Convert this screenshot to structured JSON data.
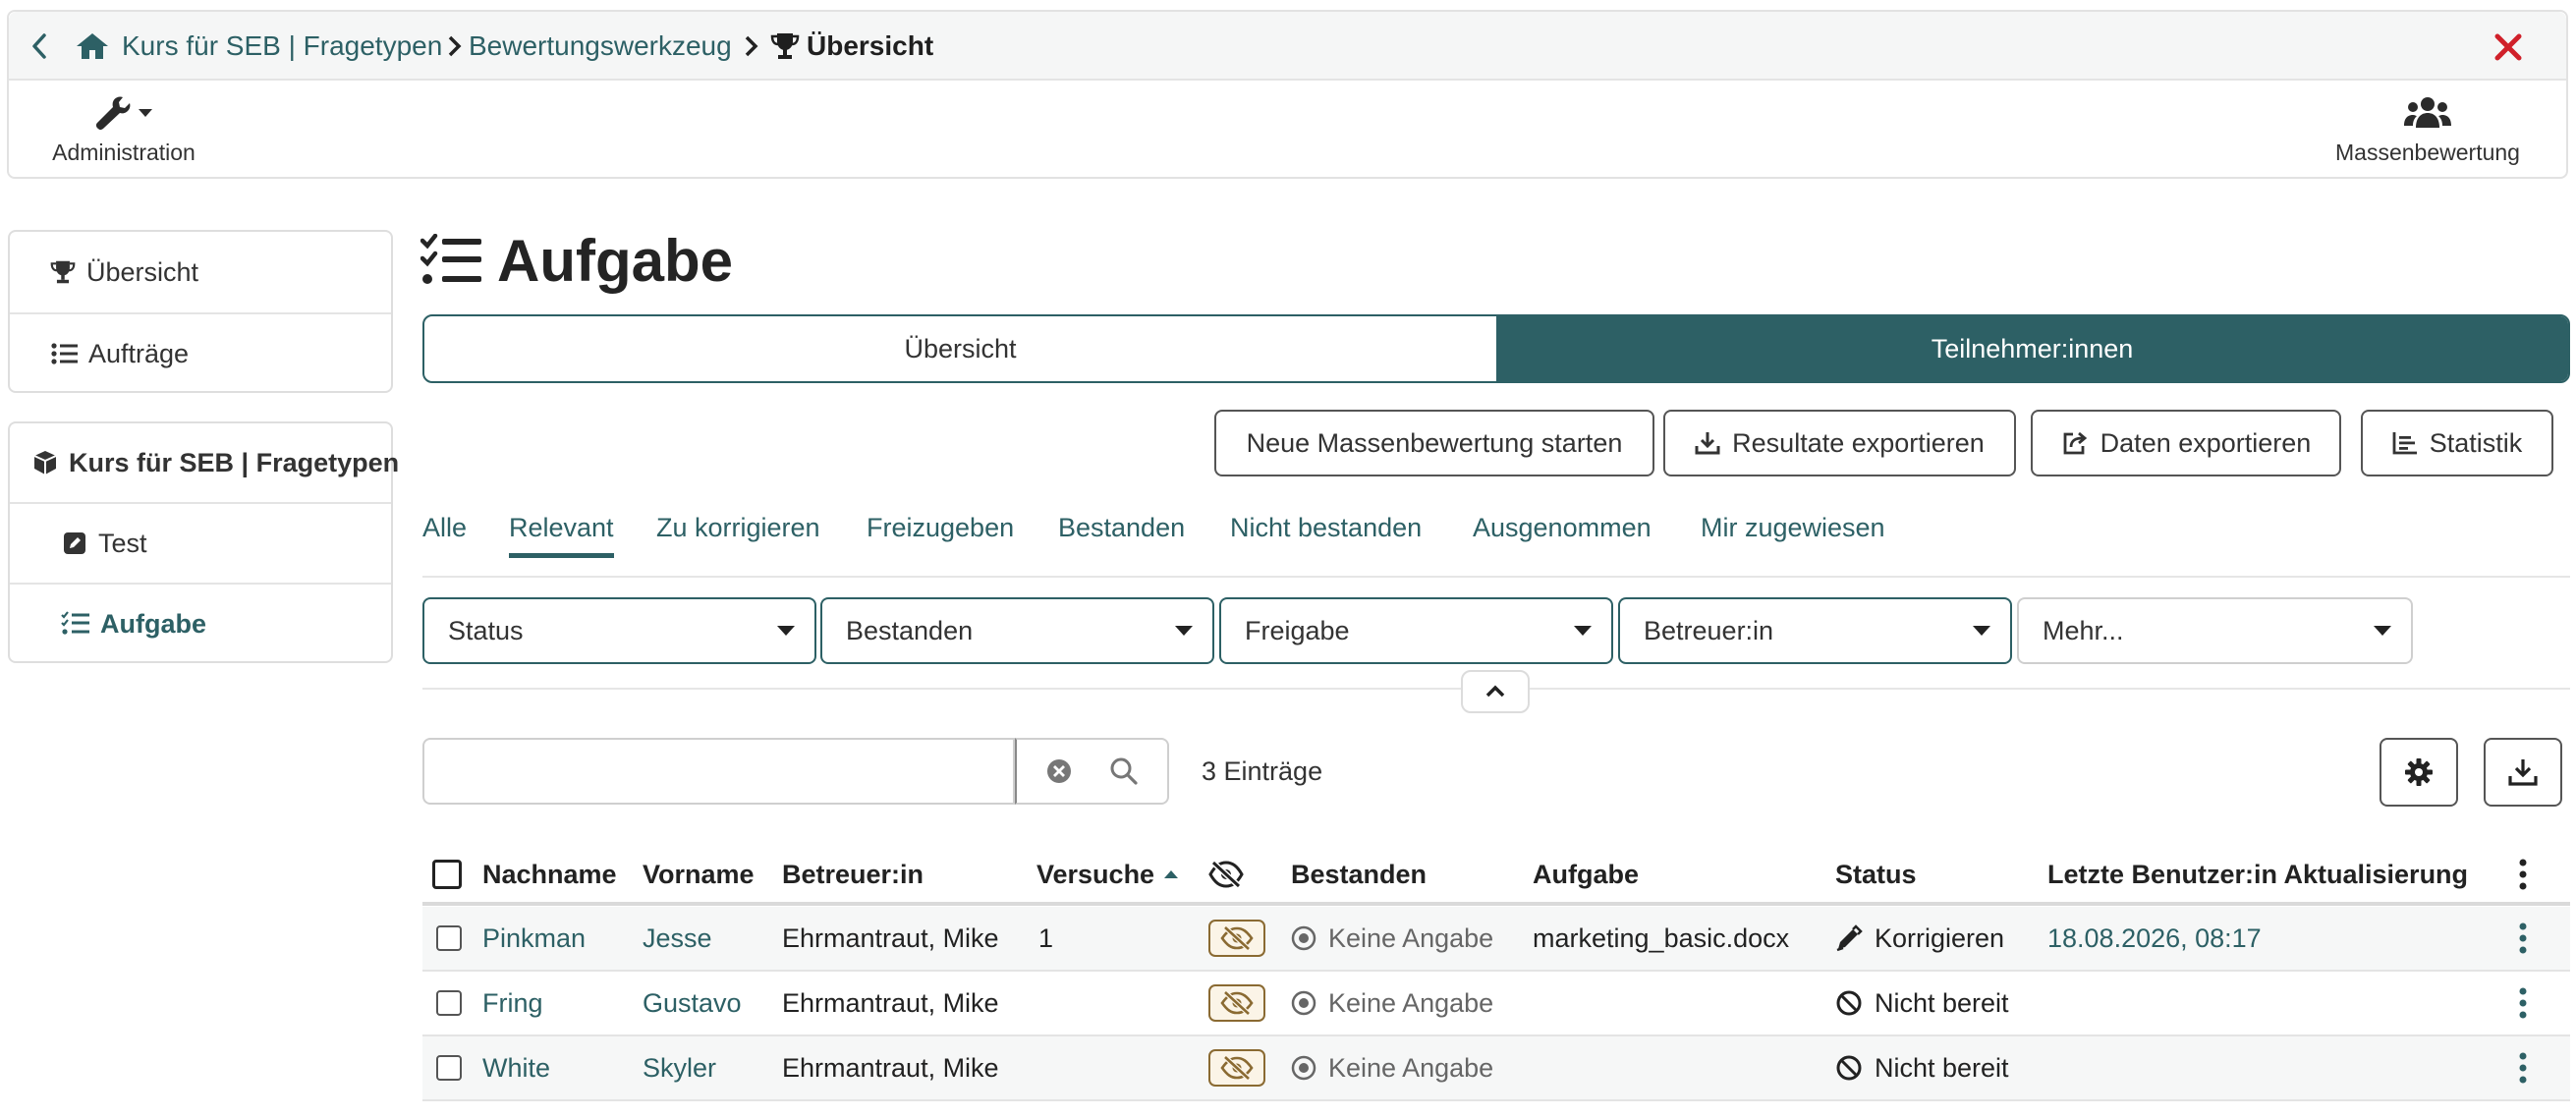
{
  "header": {
    "breadcrumb": [
      {
        "label": "Kurs für SEB | Fragetypen"
      },
      {
        "label": "Bewertungswerkzeug"
      },
      {
        "label": "Übersicht"
      }
    ],
    "admin_label": "Administration",
    "mass_label": "Massenbewertung"
  },
  "sidebar": {
    "nav": [
      {
        "label": "Übersicht",
        "icon": "trophy-icon"
      },
      {
        "label": "Aufträge",
        "icon": "list-icon"
      }
    ],
    "course": {
      "title": "Kurs für SEB | Fragetypen",
      "icon": "cube-icon"
    },
    "course_items": [
      {
        "label": "Test",
        "icon": "edit-square-icon"
      },
      {
        "label": "Aufgabe",
        "icon": "checklist-icon",
        "active": true
      }
    ]
  },
  "main": {
    "title": "Aufgabe",
    "segments": [
      {
        "label": "Übersicht",
        "active": false
      },
      {
        "label": "Teilnehmer:innen",
        "active": true
      }
    ],
    "actions": {
      "mass_start": "Neue Massenbewertung starten",
      "export_results": "Resultate exportieren",
      "export_data": "Daten exportieren",
      "statistics": "Statistik"
    },
    "tabs": [
      {
        "label": "Alle"
      },
      {
        "label": "Relevant",
        "active": true
      },
      {
        "label": "Zu korrigieren"
      },
      {
        "label": "Freizugeben"
      },
      {
        "label": "Bestanden"
      },
      {
        "label": "Nicht bestanden"
      },
      {
        "label": "Ausgenommen"
      },
      {
        "label": "Mir zugewiesen"
      }
    ],
    "filters": [
      {
        "label": "Status"
      },
      {
        "label": "Bestanden"
      },
      {
        "label": "Freigabe"
      },
      {
        "label": "Betreuer:in"
      },
      {
        "label": "Mehr..."
      }
    ],
    "search": {
      "value": "",
      "placeholder": ""
    },
    "count": "3 Einträge"
  },
  "table": {
    "columns": {
      "nachname": "Nachname",
      "vorname": "Vorname",
      "betreuer": "Betreuer:in",
      "versuche": "Versuche",
      "bestanden": "Bestanden",
      "aufgabe": "Aufgabe",
      "status": "Status",
      "letzte": "Letzte Benutzer:in Aktualisierung"
    },
    "sort": {
      "column": "Versuche",
      "direction": "ascending"
    },
    "rows": [
      {
        "nachname": "Pinkman",
        "vorname": "Jesse",
        "betreuer": "Ehrmantraut, Mike",
        "versuche": "1",
        "bestanden": "Keine Angabe",
        "aufgabe": "marketing_basic.docx",
        "status": "Korrigieren",
        "status_icon": "pen-icon",
        "letzte": "18.08.2026, 08:17"
      },
      {
        "nachname": "Fring",
        "vorname": "Gustavo",
        "betreuer": "Ehrmantraut, Mike",
        "versuche": "",
        "bestanden": "Keine Angabe",
        "aufgabe": "",
        "status": "Nicht bereit",
        "status_icon": "ban-icon",
        "letzte": ""
      },
      {
        "nachname": "White",
        "vorname": "Skyler",
        "betreuer": "Ehrmantraut, Mike",
        "versuche": "",
        "bestanden": "Keine Angabe",
        "aufgabe": "",
        "status": "Nicht bereit",
        "status_icon": "ban-icon",
        "letzte": ""
      }
    ]
  },
  "colors": {
    "accent": "#2d6065",
    "close": "#d0202a",
    "visibility_badge": "#8a6a32"
  }
}
